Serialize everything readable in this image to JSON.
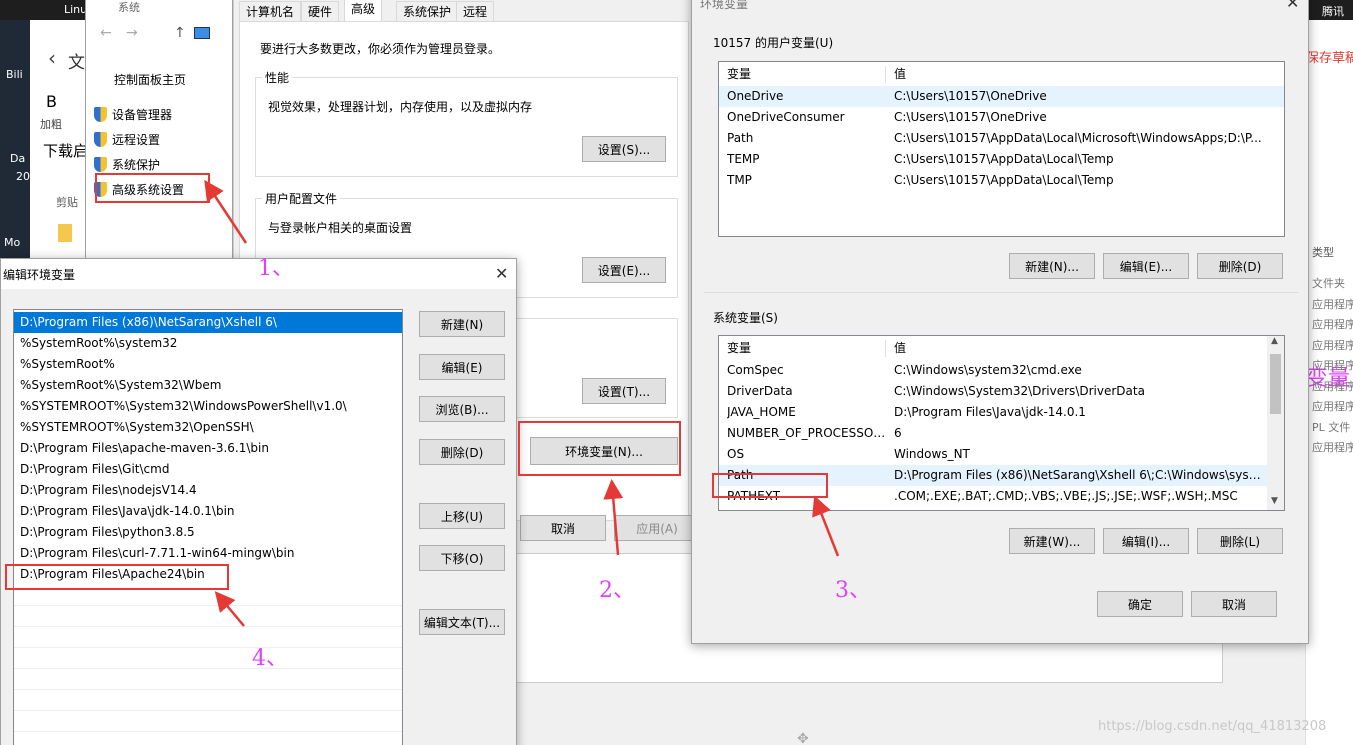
{
  "background": {
    "taskbar": {
      "item_1": "Linu",
      "item_2": "腾讯遥",
      "item_3": "Bili",
      "item_4": "Da",
      "item_5": "20",
      "item_6": "Mo"
    },
    "explorer_back": {
      "heading": "文",
      "ribbon_b": "B",
      "ribbon_add": "加粗",
      "downloads": "下载启",
      "clipboard": "剪贴"
    },
    "right_panel": {
      "save_draft": "保存草稿",
      "partial_var": "变量",
      "type_header": "类型",
      "rows": [
        "文件夹",
        "应用程序",
        "应用程序",
        "应用程序",
        "应用程序",
        "应用程序",
        "应用程序",
        "PL 文件",
        "应用程序"
      ]
    },
    "watermark": "https://blog.csdn.net/qq_41813208"
  },
  "system_panel": {
    "title": "系统",
    "home_link": "控制面板主页",
    "links": [
      "设备管理器",
      "远程设置",
      "系统保护",
      "高级系统设置"
    ]
  },
  "system_props": {
    "tabs": [
      "计算机名",
      "硬件",
      "高级",
      "系统保护",
      "远程"
    ],
    "admin_note": "要进行大多数更改，你必须作为管理员登录。",
    "performance": {
      "title": "性能",
      "desc": "视觉效果，处理器计划，内存使用，以及虚拟内存",
      "button": "设置(S)..."
    },
    "profiles": {
      "title": "用户配置文件",
      "desc": "与登录帐户相关的桌面设置",
      "button": "设置(E)..."
    },
    "startup": {
      "button": "设置(T)..."
    },
    "env_button": "环境变量(N)...",
    "cancel": "取消",
    "apply": "应用(A)"
  },
  "env_dialog": {
    "title": "环境变量",
    "user_group": "10157 的用户变量(U)",
    "col_var": "变量",
    "col_val": "值",
    "user_vars": [
      {
        "name": "OneDrive",
        "value": "C:\\Users\\10157\\OneDrive"
      },
      {
        "name": "OneDriveConsumer",
        "value": "C:\\Users\\10157\\OneDrive"
      },
      {
        "name": "Path",
        "value": "C:\\Users\\10157\\AppData\\Local\\Microsoft\\WindowsApps;D:\\P..."
      },
      {
        "name": "TEMP",
        "value": "C:\\Users\\10157\\AppData\\Local\\Temp"
      },
      {
        "name": "TMP",
        "value": "C:\\Users\\10157\\AppData\\Local\\Temp"
      }
    ],
    "user_buttons": {
      "new": "新建(N)...",
      "edit": "编辑(E)...",
      "delete": "删除(D)"
    },
    "sys_group": "系统变量(S)",
    "sys_vars": [
      {
        "name": "ComSpec",
        "value": "C:\\Windows\\system32\\cmd.exe"
      },
      {
        "name": "DriverData",
        "value": "C:\\Windows\\System32\\Drivers\\DriverData"
      },
      {
        "name": "JAVA_HOME",
        "value": "D:\\Program Files\\Java\\jdk-14.0.1"
      },
      {
        "name": "NUMBER_OF_PROCESSORS",
        "value": "6"
      },
      {
        "name": "OS",
        "value": "Windows_NT"
      },
      {
        "name": "Path",
        "value": "D:\\Program Files (x86)\\NetSarang\\Xshell 6\\;C:\\Windows\\syste..."
      },
      {
        "name": "PATHEXT",
        "value": ".COM;.EXE;.BAT;.CMD;.VBS;.VBE;.JS;.JSE;.WSF;.WSH;.MSC"
      }
    ],
    "sys_buttons": {
      "new": "新建(W)...",
      "edit": "编辑(I)...",
      "delete": "删除(L)"
    },
    "ok": "确定",
    "cancel": "取消"
  },
  "edit_dialog": {
    "title": "编辑环境变量",
    "entries": [
      "D:\\Program Files (x86)\\NetSarang\\Xshell 6\\",
      "%SystemRoot%\\system32",
      "%SystemRoot%",
      "%SystemRoot%\\System32\\Wbem",
      "%SYSTEMROOT%\\System32\\WindowsPowerShell\\v1.0\\",
      "%SYSTEMROOT%\\System32\\OpenSSH\\",
      "D:\\Program Files\\apache-maven-3.6.1\\bin",
      "D:\\Program Files\\Git\\cmd",
      "D:\\Program Files\\nodejsV14.4",
      "D:\\Program Files\\Java\\jdk-14.0.1\\bin",
      "D:\\Program Files\\python3.8.5",
      "D:\\Program Files\\curl-7.71.1-win64-mingw\\bin",
      "D:\\Program Files\\Apache24\\bin"
    ],
    "buttons": {
      "new": "新建(N)",
      "edit": "编辑(E)",
      "browse": "浏览(B)...",
      "delete": "删除(D)",
      "up": "上移(U)",
      "down": "下移(O)",
      "edit_text": "编辑文本(T)..."
    }
  },
  "annotations": [
    "1、",
    "2、",
    "3、",
    "4、"
  ],
  "colors": {
    "selection": "#0078d7",
    "hover": "#e5f3ff",
    "highlight_box": "#e53935",
    "annotation": "#e040fb"
  }
}
